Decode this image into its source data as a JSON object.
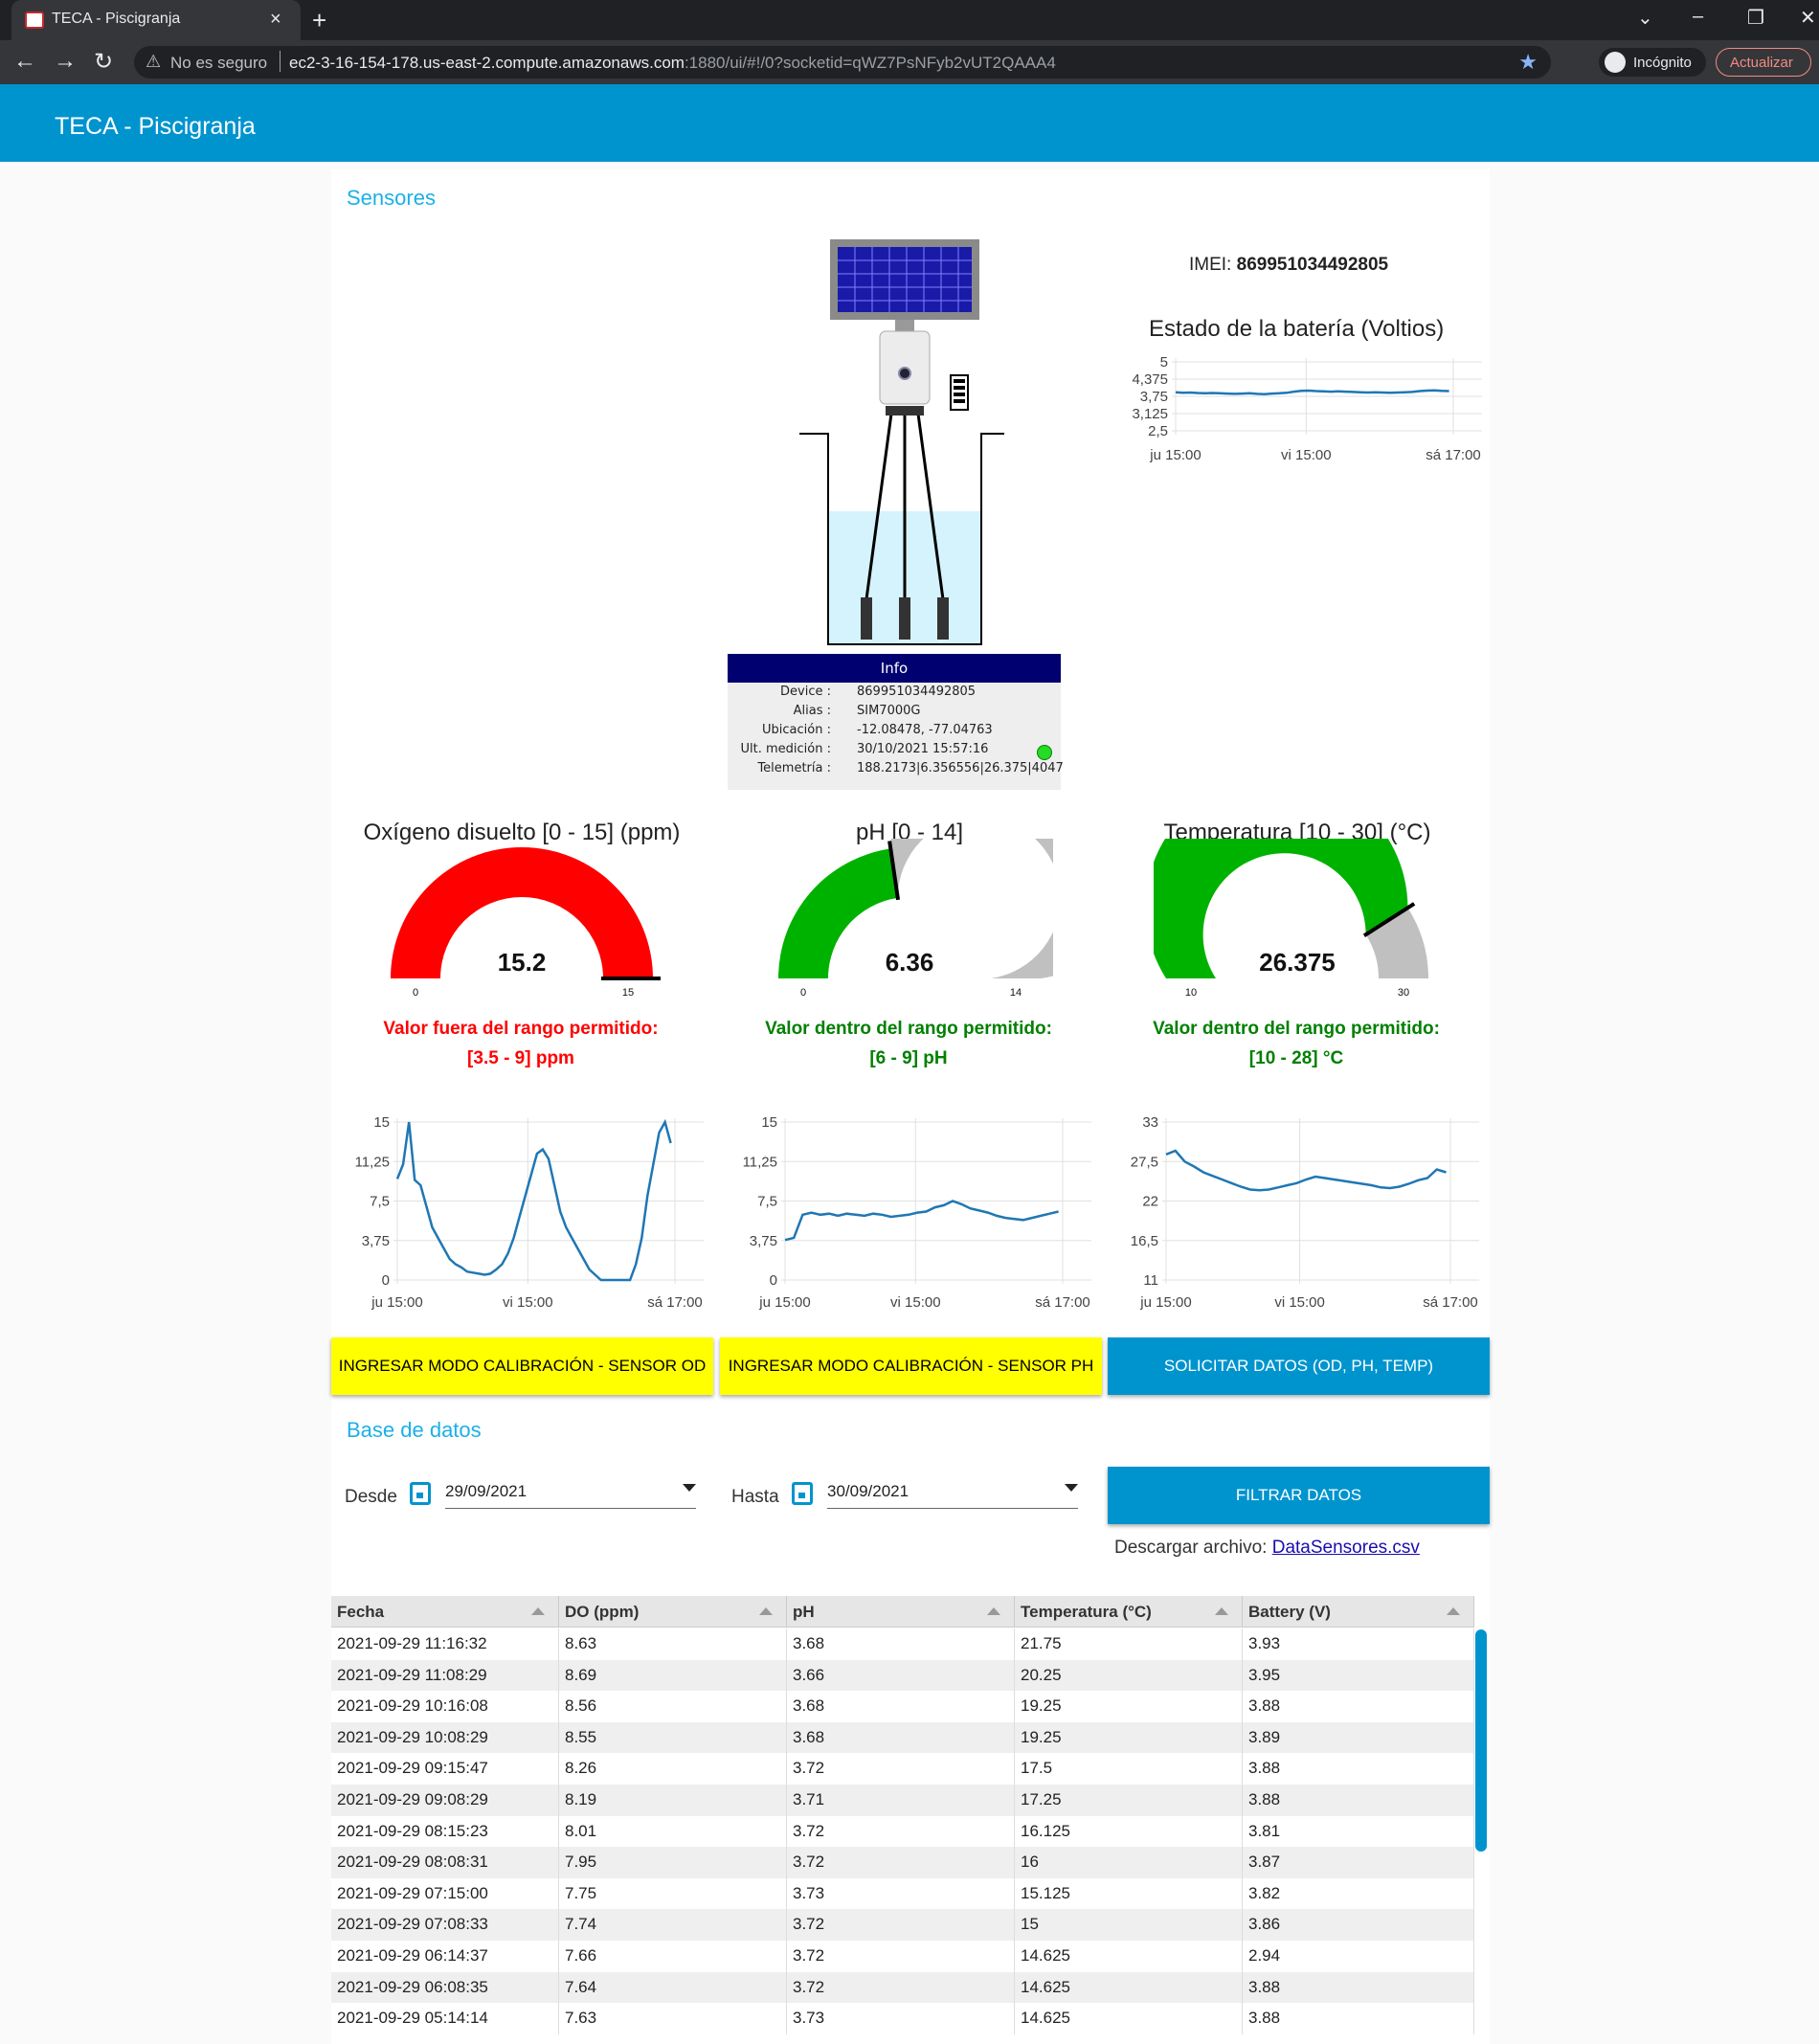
{
  "browser": {
    "tab_title": "TECA - Piscigranja",
    "tab_close": "×",
    "new_tab": "+",
    "security_label": "No es seguro",
    "url_host": "ec2-3-16-154-178.us-east-2.compute.amazonaws.com",
    "url_rest": ":1880/ui/#!/0?socketid=qWZ7PsNFyb2vUT2QAAA4",
    "incognito_label": "Incógnito",
    "update_label": "Actualizar"
  },
  "app": {
    "title": "TECA - Piscigranja"
  },
  "sensores": {
    "title": "Sensores",
    "info": {
      "header": "Info",
      "rows": [
        {
          "key": "Device :",
          "value": "869951034492805"
        },
        {
          "key": "Alias :",
          "value": "SIM7000G"
        },
        {
          "key": "Ubicación :",
          "value": "-12.08478, -77.04763"
        },
        {
          "key": "Ult. medición :",
          "value": "30/10/2021  15:57:16"
        },
        {
          "key": "Telemetría :",
          "value": "188.2173|6.356556|26.375|4047"
        }
      ],
      "status_color": "#22dd22"
    },
    "imei_label": "IMEI:",
    "imei_value": "869951034492805",
    "battery_title": "Estado de la batería (Voltios)"
  },
  "gauges": [
    {
      "title": "Oxígeno disuelto [0 - 15] (ppm)",
      "value": "15.2",
      "min": "0",
      "max": "15",
      "fraction": 1.0,
      "color": "#ff0000",
      "msg1": "Valor fuera del rango permitido:",
      "msg2": "[3.5 - 9] ppm",
      "msg_class": "red"
    },
    {
      "title": "pH [0 - 14]",
      "value": "6.36",
      "min": "0",
      "max": "14",
      "fraction": 0.454,
      "color": "#00b200",
      "msg1": "Valor dentro del rango permitido:",
      "msg2": "[6 - 9] pH",
      "msg_class": "green"
    },
    {
      "title": "Temperatura [10 - 30] (°C)",
      "value": "26.375",
      "min": "10",
      "max": "30",
      "fraction": 0.819,
      "color": "#00b200",
      "msg1": "Valor dentro del rango permitido:",
      "msg2": "[10 - 28] °C",
      "msg_class": "green"
    }
  ],
  "chart_data": [
    {
      "type": "line",
      "title": "Estado de la batería (Voltios)",
      "x_ticks": [
        "ju 15:00",
        "vi 15:00",
        "sá 17:00"
      ],
      "y_ticks": [
        "5",
        "4,375",
        "3,75",
        "3,125",
        "2,5"
      ],
      "ylim": [
        2.5,
        5
      ],
      "series": [
        {
          "values": [
            3.9,
            3.88,
            3.89,
            3.87,
            3.86,
            3.87,
            3.86,
            3.85,
            3.84,
            3.85,
            3.86,
            3.84,
            3.83,
            3.85,
            3.86,
            3.88,
            3.92,
            3.95,
            3.96,
            3.94,
            3.93,
            3.92,
            3.93,
            3.92,
            3.91,
            3.9,
            3.89,
            3.9,
            3.89,
            3.88,
            3.89,
            3.9,
            3.91,
            3.94,
            3.96,
            3.97,
            3.95,
            3.94
          ]
        }
      ]
    },
    {
      "type": "line",
      "title": "Oxígeno disuelto",
      "x_ticks": [
        "ju 15:00",
        "vi 15:00",
        "sá 17:00"
      ],
      "y_ticks": [
        "15",
        "11,25",
        "7,5",
        "3,75",
        "0"
      ],
      "ylim": [
        0,
        15
      ],
      "series": [
        {
          "values": [
            9.6,
            11,
            15,
            9.5,
            9,
            7,
            5,
            4,
            3,
            2,
            1.5,
            1.2,
            0.8,
            0.7,
            0.6,
            0.5,
            0.6,
            1,
            1.5,
            2.5,
            4,
            6,
            8,
            10,
            12,
            12.4,
            11.5,
            9,
            6.5,
            5,
            4,
            3,
            2,
            1,
            0.5,
            0,
            0,
            0,
            0,
            0,
            0,
            1.5,
            4,
            8,
            11,
            14,
            15,
            13
          ]
        }
      ]
    },
    {
      "type": "line",
      "title": "pH",
      "x_ticks": [
        "ju 15:00",
        "vi 15:00",
        "sá 17:00"
      ],
      "y_ticks": [
        "15",
        "11,25",
        "7,5",
        "3,75",
        "0"
      ],
      "ylim": [
        0,
        15
      ],
      "series": [
        {
          "values": [
            3.8,
            4,
            6.2,
            6.4,
            6.2,
            6.3,
            6.1,
            6.3,
            6.2,
            6.1,
            6.3,
            6.2,
            6,
            6.1,
            6.2,
            6.4,
            6.5,
            6.9,
            7.1,
            7.5,
            7.2,
            6.8,
            6.6,
            6.4,
            6.1,
            5.9,
            5.8,
            5.7,
            5.9,
            6.1,
            6.3,
            6.5
          ]
        }
      ]
    },
    {
      "type": "line",
      "title": "Temperatura",
      "x_ticks": [
        "ju 15:00",
        "vi 15:00",
        "sá 17:00"
      ],
      "y_ticks": [
        "33",
        "27,5",
        "22",
        "16,5",
        "11"
      ],
      "ylim": [
        11,
        33
      ],
      "series": [
        {
          "values": [
            28.5,
            29,
            27.5,
            26.8,
            26,
            25.5,
            25,
            24.5,
            24,
            23.6,
            23.5,
            23.6,
            23.9,
            24.2,
            24.5,
            25,
            25.4,
            25.2,
            25,
            24.8,
            24.6,
            24.4,
            24.2,
            23.9,
            23.8,
            24,
            24.4,
            24.9,
            25.2,
            26.4,
            26
          ]
        }
      ]
    }
  ],
  "buttons": {
    "calib_od": "INGRESAR MODO CALIBRACIÓN - SENSOR OD",
    "calib_ph": "INGRESAR MODO CALIBRACIÓN - SENSOR PH",
    "request": "SOLICITAR DATOS (OD, PH, TEMP)",
    "filter": "FILTRAR DATOS"
  },
  "db": {
    "title": "Base de datos",
    "from_label": "Desde",
    "from_value": "29/09/2021",
    "to_label": "Hasta",
    "to_value": "30/09/2021",
    "download_label": "Descargar archivo:",
    "download_link": "DataSensores.csv",
    "columns": [
      "Fecha",
      "DO (ppm)",
      "pH",
      "Temperatura (°C)",
      "Battery (V)"
    ],
    "rows": [
      [
        "2021-09-29 11:16:32",
        "8.63",
        "3.68",
        "21.75",
        "3.93"
      ],
      [
        "2021-09-29 11:08:29",
        "8.69",
        "3.66",
        "20.25",
        "3.95"
      ],
      [
        "2021-09-29 10:16:08",
        "8.56",
        "3.68",
        "19.25",
        "3.88"
      ],
      [
        "2021-09-29 10:08:29",
        "8.55",
        "3.68",
        "19.25",
        "3.89"
      ],
      [
        "2021-09-29 09:15:47",
        "8.26",
        "3.72",
        "17.5",
        "3.88"
      ],
      [
        "2021-09-29 09:08:29",
        "8.19",
        "3.71",
        "17.25",
        "3.88"
      ],
      [
        "2021-09-29 08:15:23",
        "8.01",
        "3.72",
        "16.125",
        "3.81"
      ],
      [
        "2021-09-29 08:08:31",
        "7.95",
        "3.72",
        "16",
        "3.87"
      ],
      [
        "2021-09-29 07:15:00",
        "7.75",
        "3.73",
        "15.125",
        "3.82"
      ],
      [
        "2021-09-29 07:08:33",
        "7.74",
        "3.72",
        "15",
        "3.86"
      ],
      [
        "2021-09-29 06:14:37",
        "7.66",
        "3.72",
        "14.625",
        "2.94"
      ],
      [
        "2021-09-29 06:08:35",
        "7.64",
        "3.72",
        "14.625",
        "3.88"
      ],
      [
        "2021-09-29 05:14:14",
        "7.63",
        "3.73",
        "14.625",
        "3.88"
      ]
    ]
  }
}
